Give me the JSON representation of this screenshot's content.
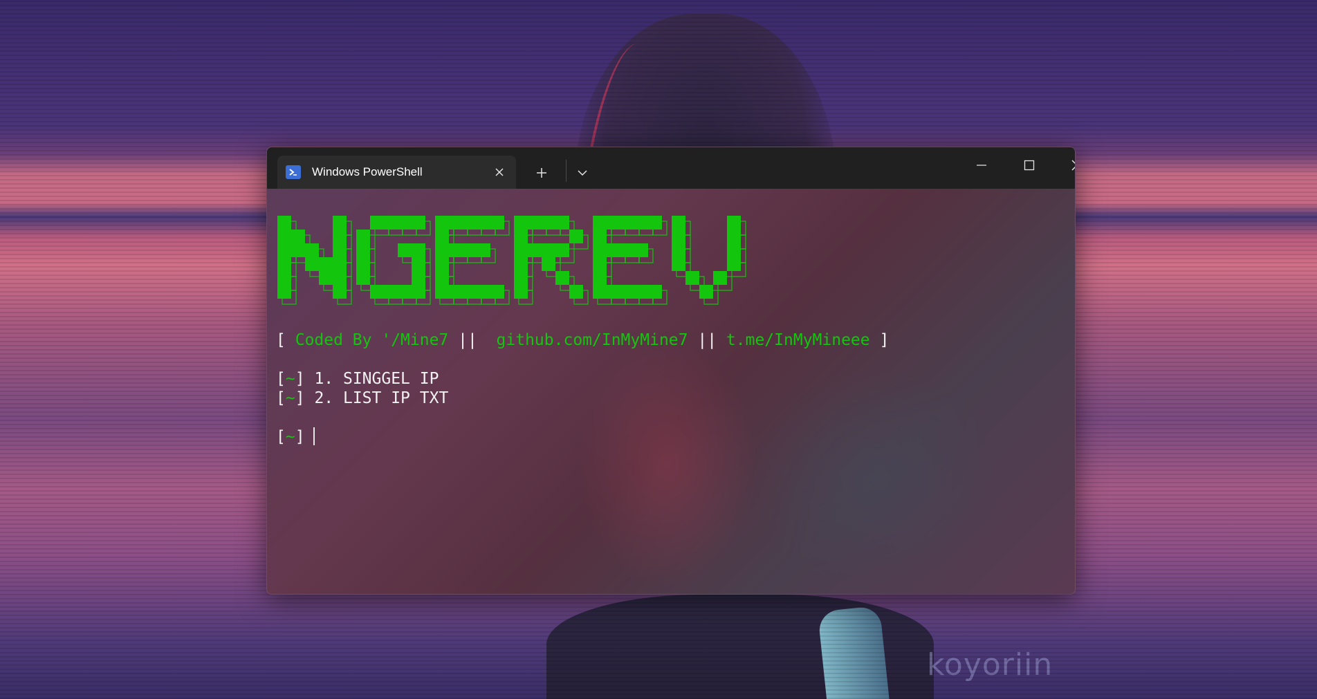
{
  "window": {
    "tab_title": "Windows PowerShell",
    "tab_icon": "powershell-icon",
    "new_tab_label": "+",
    "accent": "#13c60d"
  },
  "banner": {
    "text": "NGEREV",
    "color": "#13c60d"
  },
  "credits": {
    "open": "[",
    "coded_by": "Coded By '/Mine7",
    "sep1": "||",
    "github": "github.com/InMyMine7",
    "sep2": "||",
    "telegram": "t.me/InMyMineee",
    "close": "]"
  },
  "menu": [
    {
      "prefix_open": "[",
      "prefix_mark": "~",
      "prefix_close": "]",
      "label": "1. SINGGEL IP"
    },
    {
      "prefix_open": "[",
      "prefix_mark": "~",
      "prefix_close": "]",
      "label": "2. LIST IP TXT"
    }
  ],
  "prompt": {
    "open": "[",
    "mark": "~",
    "close": "]"
  },
  "wallpaper": {
    "watermark": "koyoriin"
  }
}
